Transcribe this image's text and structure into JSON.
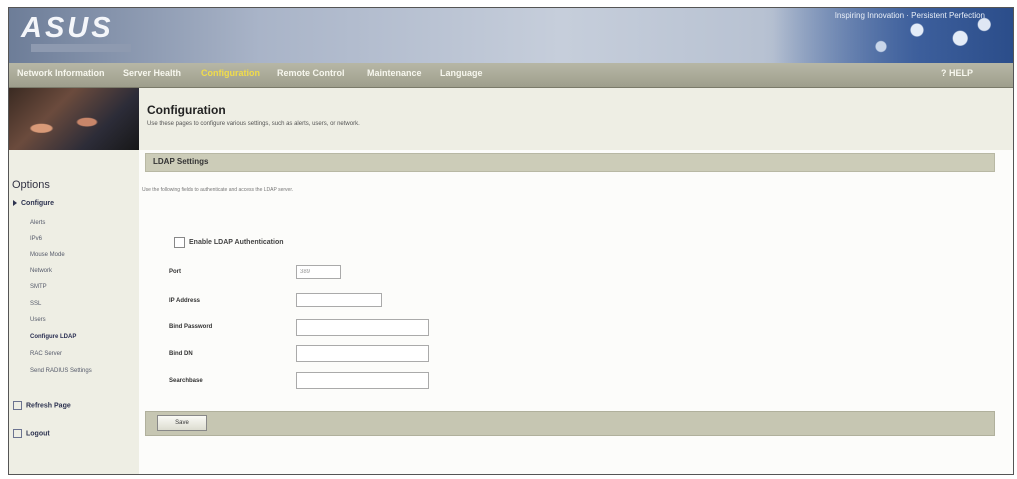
{
  "header": {
    "logo": "ASUS",
    "tagline": "Inspiring Innovation · Persistent Perfection"
  },
  "nav": {
    "items": [
      "Network Information",
      "Server Health",
      "Configuration",
      "Remote Control",
      "Maintenance",
      "Language"
    ],
    "active": "Configuration",
    "help": "? HELP"
  },
  "banner": {
    "title": "Configuration",
    "description": "Use these pages to configure various settings, such as alerts, users, or network."
  },
  "sidebar": {
    "heading": "Options",
    "parent": "Configure",
    "items": [
      "Alerts",
      "IPv6",
      "Mouse Mode",
      "Network",
      "SMTP",
      "SSL",
      "Users",
      "Configure LDAP",
      "RAC Server",
      "Send RADIUS Settings"
    ],
    "active_item": "Configure LDAP",
    "actions": [
      "Refresh Page",
      "Logout"
    ]
  },
  "ldap": {
    "section_title": "LDAP Settings",
    "instructions": "Use the following fields to authenticate and access the LDAP server.",
    "enable_label": "Enable LDAP Authentication",
    "enable_checked": false,
    "fields": [
      {
        "label": "Port",
        "value": "389"
      },
      {
        "label": "IP Address",
        "value": ""
      },
      {
        "label": "Bind Password",
        "value": ""
      },
      {
        "label": "Bind DN",
        "value": ""
      },
      {
        "label": "Searchbase",
        "value": ""
      }
    ],
    "save_label": "Save"
  }
}
